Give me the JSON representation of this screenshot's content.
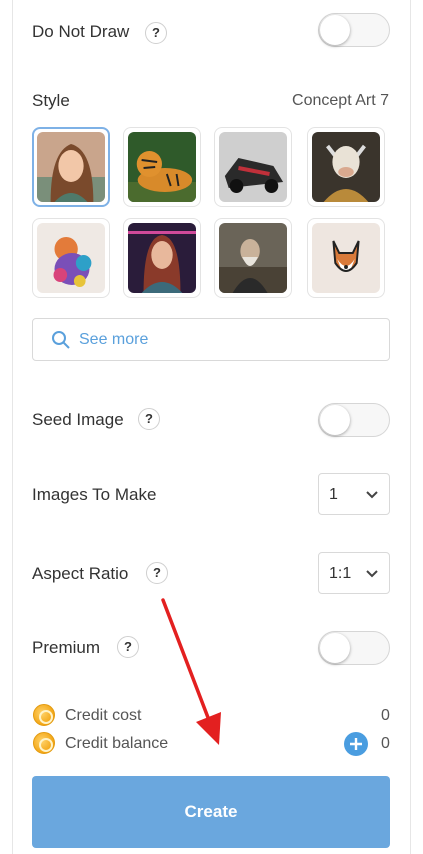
{
  "do_not_draw": {
    "label": "Do Not Draw",
    "help": "?",
    "enabled": false
  },
  "style": {
    "label": "Style",
    "selected_value": "Concept Art 7",
    "thumbnails": [
      {
        "name": "portrait-woman"
      },
      {
        "name": "tiger"
      },
      {
        "name": "race-car"
      },
      {
        "name": "cow-robot"
      },
      {
        "name": "colorful-dog"
      },
      {
        "name": "cyber-woman"
      },
      {
        "name": "old-man-painting"
      },
      {
        "name": "dog-sketch"
      }
    ],
    "see_more_label": "See more"
  },
  "seed_image": {
    "label": "Seed Image",
    "help": "?",
    "enabled": false
  },
  "images_to_make": {
    "label": "Images To Make",
    "value": "1"
  },
  "aspect_ratio": {
    "label": "Aspect Ratio",
    "help": "?",
    "value": "1:1"
  },
  "premium": {
    "label": "Premium",
    "help": "?",
    "enabled": false
  },
  "credits": {
    "cost_label": "Credit cost",
    "cost_value": "0",
    "balance_label": "Credit balance",
    "balance_value": "0"
  },
  "create_label": "Create",
  "colors": {
    "accent": "#5aa0dc",
    "create_button": "#6aa7de",
    "annotation_arrow": "#e32020"
  }
}
